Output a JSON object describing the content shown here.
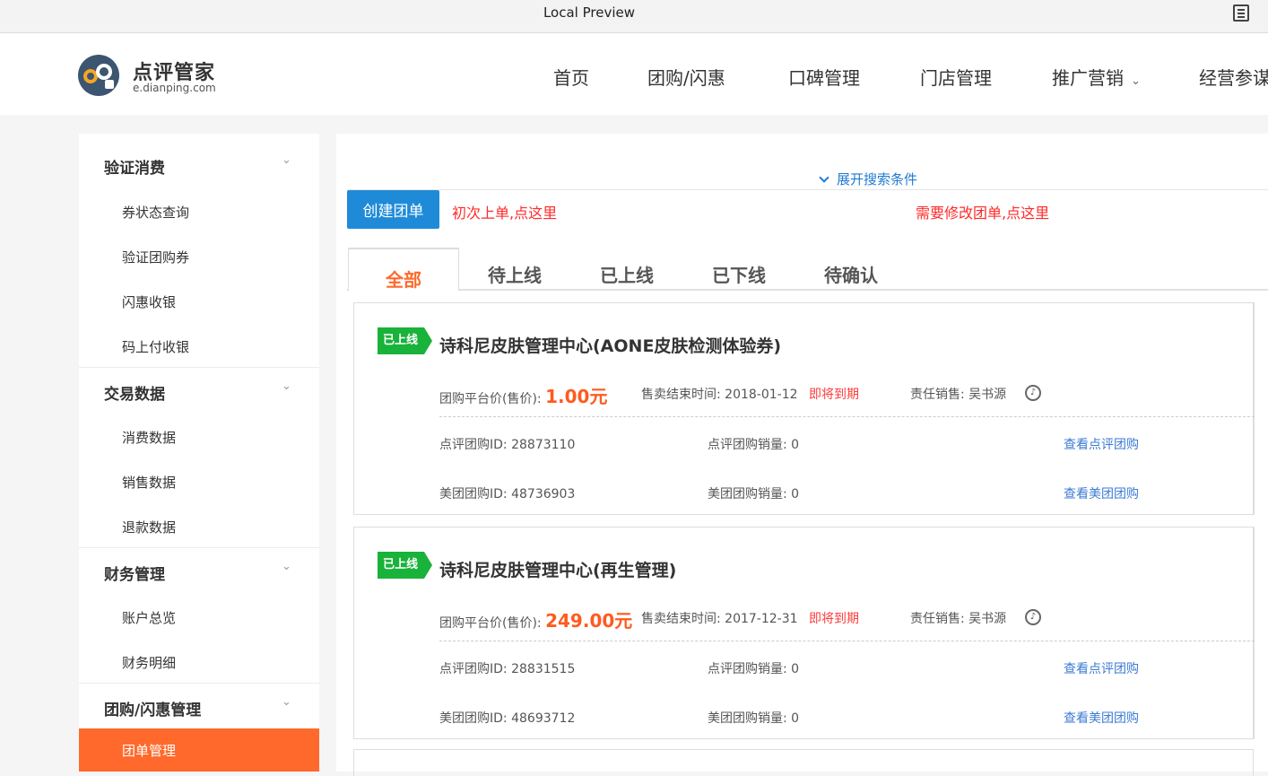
{
  "preview": {
    "title": "Local Preview",
    "icon": "document-icon"
  },
  "header": {
    "logo_name": "点评管家",
    "logo_sub": "e.dianping.com",
    "nav": [
      "首页",
      "团购/闪惠",
      "口碑管理",
      "门店管理",
      "推广营销",
      "经营参谋"
    ],
    "nav_caret": "⌄"
  },
  "sidebar": {
    "groups": [
      {
        "title": "验证消费",
        "items": [
          "券状态查询",
          "验证团购券",
          "闪惠收银",
          "码上付收银"
        ]
      },
      {
        "title": "交易数据",
        "items": [
          "消费数据",
          "销售数据",
          "退款数据"
        ]
      },
      {
        "title": "财务管理",
        "items": [
          "账户总览",
          "财务明细"
        ]
      },
      {
        "title": "团购/闪惠管理",
        "items": [
          "团单管理"
        ]
      }
    ],
    "chevron": "⌄",
    "active_item": "团单管理"
  },
  "main": {
    "expand_search": "展开搜索条件",
    "create_button": "创建团单",
    "first_order_link": "初次上单,点这里",
    "modify_order_link": "需要修改团单,点这里",
    "tabs": [
      "全部",
      "待上线",
      "已上线",
      "已下线",
      "待确认"
    ],
    "active_tab": "全部",
    "deals": [
      {
        "status": "已上线",
        "title": "诗科尼皮肤管理中心(AONE皮肤检测体验券)",
        "price_label": "团购平台价(售价):",
        "price": "1.00元",
        "end_label": "售卖结束时间:",
        "end_date": "2018-01-12",
        "expiring": "即将到期",
        "sales_label": "责任销售:",
        "sales_person": "吴书源",
        "dp_id_label": "点评团购ID:",
        "dp_id": "28873110",
        "dp_sales_label": "点评团购销量:",
        "dp_sales": "0",
        "dp_link": "查看点评团购",
        "mt_id_label": "美团团购ID:",
        "mt_id": "48736903",
        "mt_sales_label": "美团团购销量:",
        "mt_sales": "0",
        "mt_link": "查看美团团购"
      },
      {
        "status": "已上线",
        "title": "诗科尼皮肤管理中心(再生管理)",
        "price_label": "团购平台价(售价):",
        "price": "249.00元",
        "end_label": "售卖结束时间:",
        "end_date": "2017-12-31",
        "expiring": "即将到期",
        "sales_label": "责任销售:",
        "sales_person": "吴书源",
        "dp_id_label": "点评团购ID:",
        "dp_id": "28831515",
        "dp_sales_label": "点评团购销量:",
        "dp_sales": "0",
        "dp_link": "查看点评团购",
        "mt_id_label": "美团团购ID:",
        "mt_id": "48693712",
        "mt_sales_label": "美团团购销量:",
        "mt_sales": "0",
        "mt_link": "查看美团团购"
      }
    ]
  },
  "colors": {
    "accent": "#ff6a2c",
    "primary": "#1f8bd8",
    "online": "#19b23a",
    "link": "#3c7bd4",
    "alert": "#ff2a2a"
  }
}
